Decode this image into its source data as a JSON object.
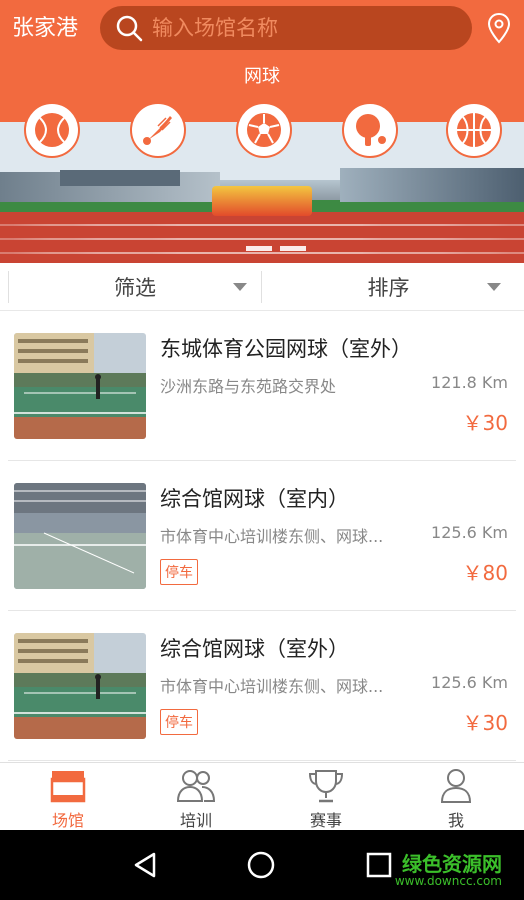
{
  "header": {
    "city": "张家港",
    "search_placeholder": "输入场馆名称",
    "category_title": "网球"
  },
  "sports": [
    {
      "icon": "tennis-ball-icon"
    },
    {
      "icon": "badminton-icon"
    },
    {
      "icon": "soccer-ball-icon"
    },
    {
      "icon": "table-tennis-icon"
    },
    {
      "icon": "basketball-icon"
    }
  ],
  "filters": {
    "filter_label": "筛选",
    "sort_label": "排序"
  },
  "venues": [
    {
      "name": "东城体育公园网球（室外）",
      "address": "沙洲东路与东苑路交界处",
      "distance": "121.8 Km",
      "price": "￥30",
      "tag": ""
    },
    {
      "name": "综合馆网球（室内）",
      "address": "市体育中心培训楼东侧、网球...",
      "distance": "125.6 Km",
      "price": "￥80",
      "tag": "停车"
    },
    {
      "name": "综合馆网球（室外）",
      "address": "市体育中心培训楼东侧、网球...",
      "distance": "125.6 Km",
      "price": "￥30",
      "tag": "停车"
    }
  ],
  "tabs": [
    {
      "label": "场馆",
      "icon": "venue-store-icon",
      "active": true
    },
    {
      "label": "培训",
      "icon": "training-people-icon",
      "active": false
    },
    {
      "label": "赛事",
      "icon": "trophy-icon",
      "active": false
    },
    {
      "label": "我",
      "icon": "user-icon",
      "active": false
    }
  ],
  "watermark": {
    "text": "绿色资源网",
    "url": "www.downcc.com"
  },
  "colors": {
    "accent": "#f26a3f",
    "search_bg": "#b9461f"
  }
}
